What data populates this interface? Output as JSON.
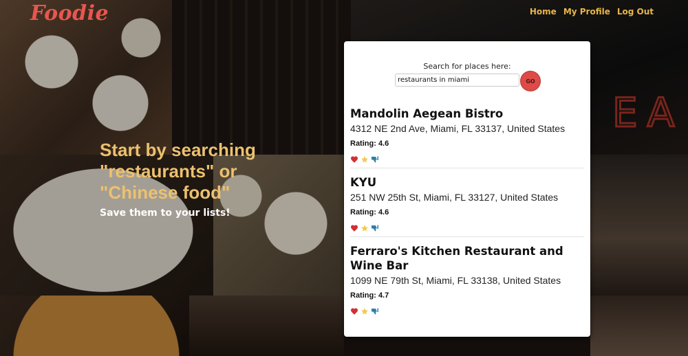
{
  "app": {
    "logo": "Foodie"
  },
  "nav": {
    "home": "Home",
    "profile": "My Profile",
    "logout": "Log Out"
  },
  "hero": {
    "title": "Start by searching \"restaurants\" or \"Chinese food\"",
    "subtitle": "Save them to your lists!"
  },
  "search": {
    "label": "Search for places here:",
    "value": "restaurants in miami",
    "button": "GO"
  },
  "background_sign": "EA",
  "results": [
    {
      "name": "Mandolin Aegean Bistro",
      "address": "4312 NE 2nd Ave, Miami, FL 33137, United States",
      "rating": "Rating: 4.6"
    },
    {
      "name": "KYU",
      "address": "251 NW 25th St, Miami, FL 33127, United States",
      "rating": "Rating: 4.6"
    },
    {
      "name": "Ferraro's Kitchen Restaurant and Wine Bar",
      "address": "1099 NE 79th St, Miami, FL 33138, United States",
      "rating": "Rating: 4.7"
    }
  ],
  "colors": {
    "logo": "#e8564f",
    "nav": "#e7b64a",
    "hero_title": "#ecc16f",
    "go_button": "#de4b47",
    "heart": "#d22f35",
    "star": "#f2c94c",
    "thumb": "#2f7fa8"
  },
  "icons": [
    "heart-icon",
    "star-icon",
    "thumbs-down-icon"
  ]
}
